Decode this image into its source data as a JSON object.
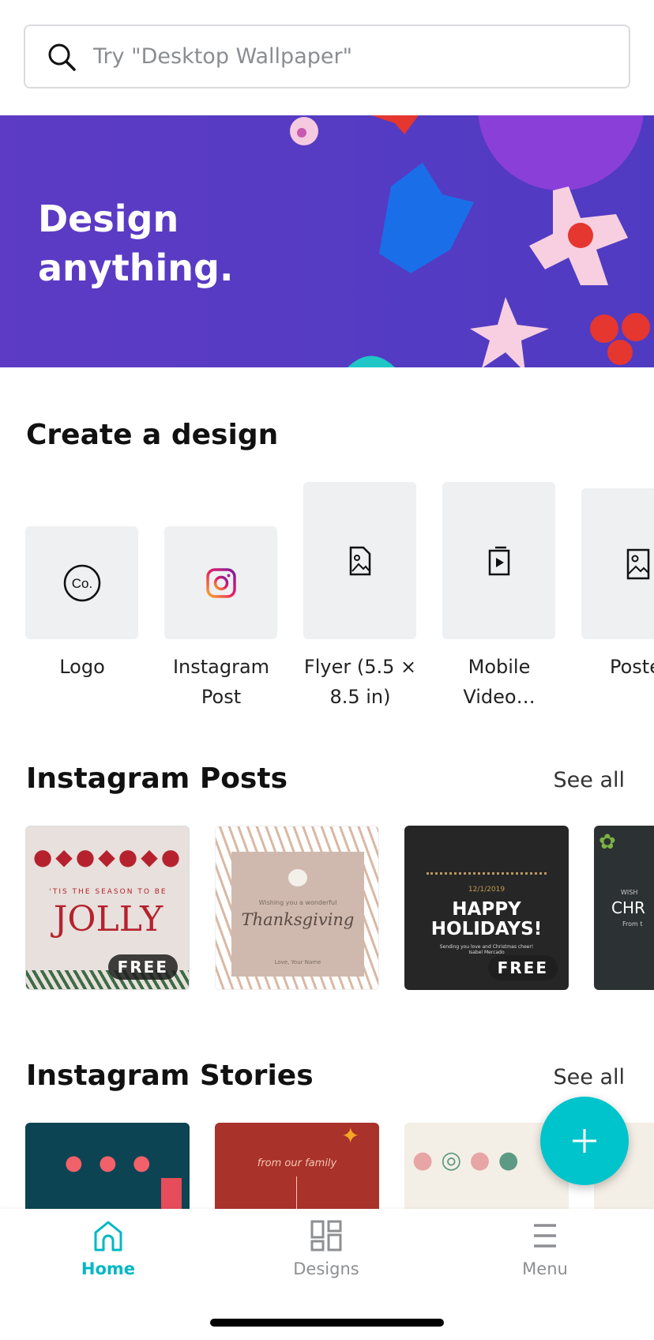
{
  "search": {
    "placeholder": "Try \"Desktop Wallpaper\"",
    "icon": "search-icon"
  },
  "banner": {
    "line1": "Design",
    "line2": "anything."
  },
  "create": {
    "title": "Create a design",
    "items": [
      {
        "label1": "Logo",
        "label2": "",
        "icon": "logo-co-icon"
      },
      {
        "label1": "Instagram",
        "label2": "Post",
        "icon": "instagram-icon"
      },
      {
        "label1": "Flyer (5.5 ×",
        "label2": "8.5 in)",
        "icon": "document-image-icon"
      },
      {
        "label1": "Mobile",
        "label2": "Video…",
        "icon": "video-file-icon"
      },
      {
        "label1": "Poste",
        "label2": "",
        "icon": "image-icon"
      }
    ]
  },
  "posts": {
    "title": "Instagram Posts",
    "see_all": "See all",
    "cards": [
      {
        "small": "'TIS THE SEASON TO BE",
        "big": "JOLLY",
        "badge": "FREE"
      },
      {
        "small": "Wishing you a wonderful",
        "big": "Thanksgiving",
        "footer": "Love, Your Name"
      },
      {
        "date": "12/1/2019",
        "big": "HAPPY HOLIDAYS!",
        "small": "Sending you love and Christmas cheer! Isabel Mercado",
        "badge": "FREE"
      },
      {
        "small": "WISH",
        "big": "CHR",
        "footer": "From t"
      }
    ]
  },
  "stories": {
    "title": "Instagram Stories",
    "see_all": "See all",
    "cards": [
      {
        "text": ""
      },
      {
        "text": "from our family"
      },
      {
        "text": ""
      }
    ]
  },
  "nav": {
    "home": "Home",
    "designs": "Designs",
    "menu": "Menu"
  },
  "colors": {
    "accent": "#00c4cc",
    "banner": "#5d3bc4"
  }
}
